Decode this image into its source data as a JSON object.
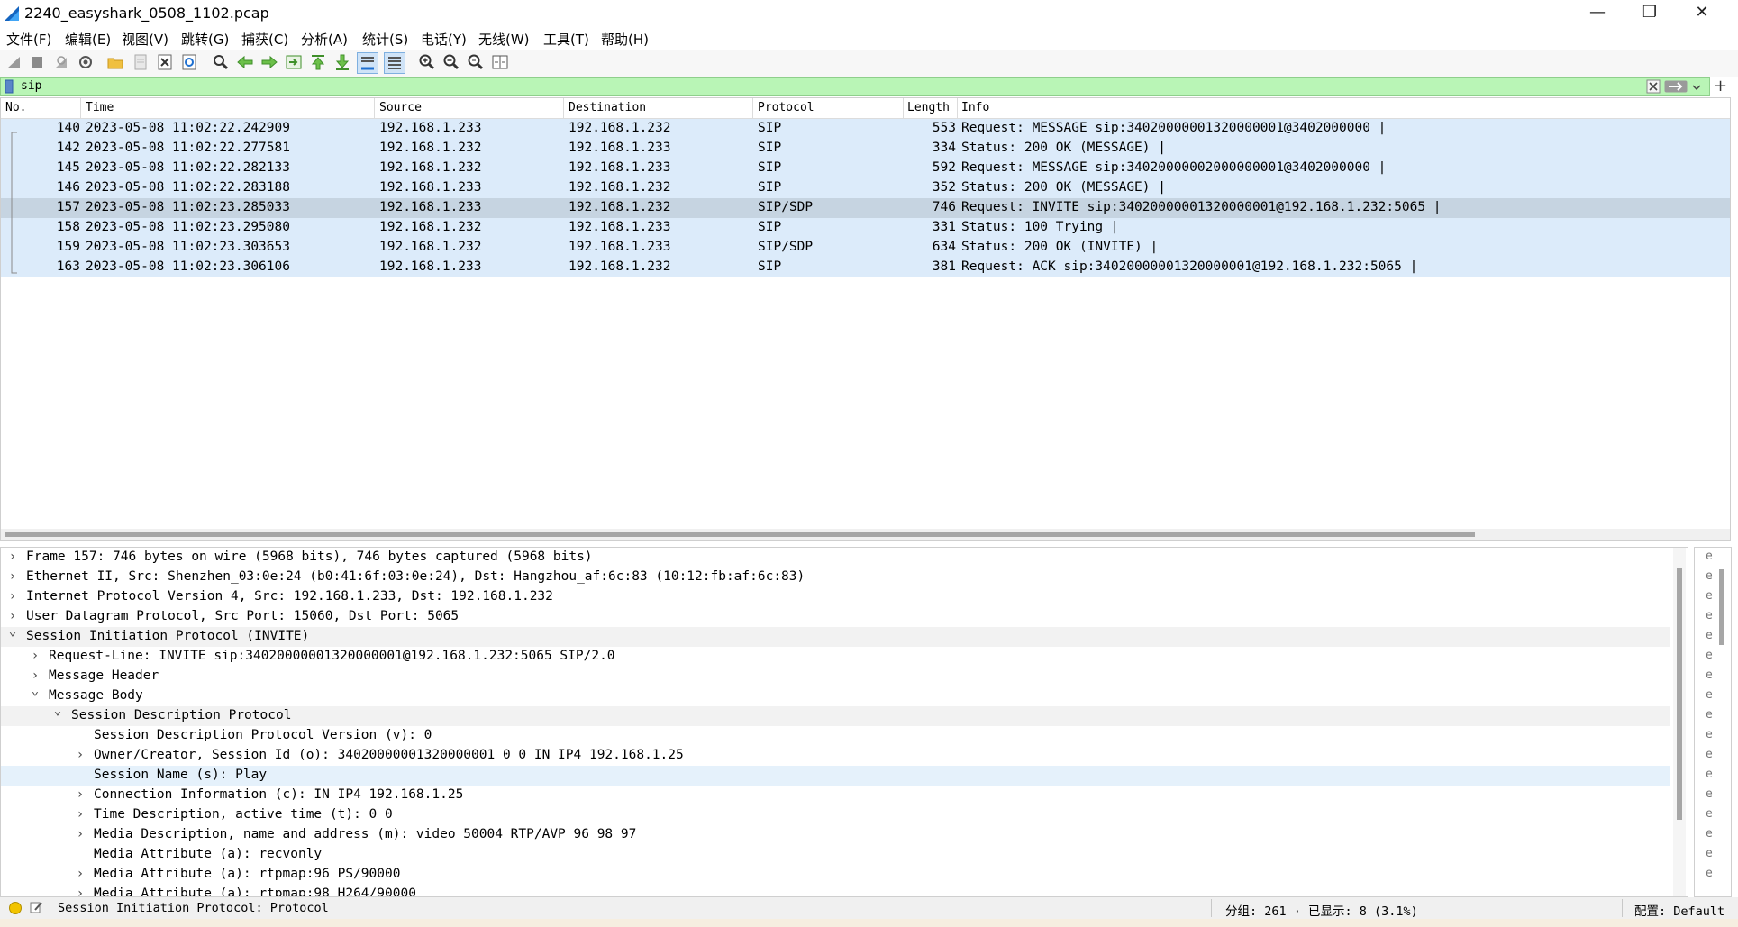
{
  "window": {
    "title": "2240_easyshark_0508_1102.pcap",
    "minimize": "—",
    "maximize": "❐",
    "close": "✕"
  },
  "menu": [
    "文件(F)",
    "编辑(E)",
    "视图(V)",
    "跳转(G)",
    "捕获(C)",
    "分析(A)",
    "统计(S)",
    "电话(Y)",
    "无线(W)",
    "工具(T)",
    "帮助(H)"
  ],
  "toolbar": {
    "icons": [
      "start-capture-icon",
      "stop-capture-icon",
      "restart-capture-icon",
      "capture-options-icon",
      "open-file-icon",
      "save-file-icon",
      "close-file-icon",
      "reload-file-icon",
      "find-packet-icon",
      "go-back-icon",
      "go-forward-icon",
      "go-to-packet-icon",
      "go-first-packet-icon",
      "go-last-packet-icon",
      "auto-scroll-icon",
      "colorize-icon",
      "zoom-in-icon",
      "zoom-out-icon",
      "zoom-normal-icon",
      "resize-columns-icon"
    ]
  },
  "filter": {
    "value": "sip",
    "add": "+"
  },
  "packet_list": {
    "columns": [
      "No.",
      "Time",
      "Source",
      "Destination",
      "Protocol",
      "Length",
      "Info"
    ],
    "rows": [
      {
        "no": "140",
        "time": "2023-05-08 11:02:22.242909",
        "src": "192.168.1.233",
        "dst": "192.168.1.232",
        "proto": "SIP",
        "len": "553",
        "info": "Request: MESSAGE sip:34020000001320000001@3402000000 |"
      },
      {
        "no": "142",
        "time": "2023-05-08 11:02:22.277581",
        "src": "192.168.1.232",
        "dst": "192.168.1.233",
        "proto": "SIP",
        "len": "334",
        "info": "Status: 200 OK (MESSAGE) |"
      },
      {
        "no": "145",
        "time": "2023-05-08 11:02:22.282133",
        "src": "192.168.1.232",
        "dst": "192.168.1.233",
        "proto": "SIP",
        "len": "592",
        "info": "Request: MESSAGE sip:34020000002000000001@3402000000 |"
      },
      {
        "no": "146",
        "time": "2023-05-08 11:02:22.283188",
        "src": "192.168.1.233",
        "dst": "192.168.1.232",
        "proto": "SIP",
        "len": "352",
        "info": "Status: 200 OK (MESSAGE) |"
      },
      {
        "no": "157",
        "time": "2023-05-08 11:02:23.285033",
        "src": "192.168.1.233",
        "dst": "192.168.1.232",
        "proto": "SIP/SDP",
        "len": "746",
        "info": "Request: INVITE sip:34020000001320000001@192.168.1.232:5065 |",
        "selected": true
      },
      {
        "no": "158",
        "time": "2023-05-08 11:02:23.295080",
        "src": "192.168.1.232",
        "dst": "192.168.1.233",
        "proto": "SIP",
        "len": "331",
        "info": "Status: 100 Trying |"
      },
      {
        "no": "159",
        "time": "2023-05-08 11:02:23.303653",
        "src": "192.168.1.232",
        "dst": "192.168.1.233",
        "proto": "SIP/SDP",
        "len": "634",
        "info": "Status: 200 OK (INVITE) |"
      },
      {
        "no": "163",
        "time": "2023-05-08 11:02:23.306106",
        "src": "192.168.1.233",
        "dst": "192.168.1.232",
        "proto": "SIP",
        "len": "381",
        "info": "Request: ACK sip:34020000001320000001@192.168.1.232:5065 |"
      }
    ]
  },
  "details": {
    "rows": [
      {
        "level": 0,
        "state": "collapsed",
        "text": "Frame 157: 746 bytes on wire (5968 bits), 746 bytes captured (5968 bits)"
      },
      {
        "level": 0,
        "state": "collapsed",
        "text": "Ethernet II, Src: Shenzhen_03:0e:24 (b0:41:6f:03:0e:24), Dst: Hangzhou_af:6c:83 (10:12:fb:af:6c:83)"
      },
      {
        "level": 0,
        "state": "collapsed",
        "text": "Internet Protocol Version 4, Src: 192.168.1.233, Dst: 192.168.1.232"
      },
      {
        "level": 0,
        "state": "collapsed",
        "text": "User Datagram Protocol, Src Port: 15060, Dst Port: 5065"
      },
      {
        "level": 0,
        "state": "expanded",
        "text": "Session Initiation Protocol (INVITE)"
      },
      {
        "level": 1,
        "state": "collapsed",
        "text": "Request-Line: INVITE sip:34020000001320000001@192.168.1.232:5065 SIP/2.0"
      },
      {
        "level": 1,
        "state": "collapsed",
        "text": "Message Header"
      },
      {
        "level": 1,
        "state": "expanded",
        "text": "Message Body"
      },
      {
        "level": 2,
        "state": "expanded",
        "text": "Session Description Protocol"
      },
      {
        "level": 3,
        "state": "none",
        "text": "Session Description Protocol Version (v): 0"
      },
      {
        "level": 3,
        "state": "collapsed",
        "text": "Owner/Creator, Session Id (o): 34020000001320000001 0 0 IN IP4 192.168.1.25"
      },
      {
        "level": 3,
        "state": "none",
        "text": "Session Name (s): Play",
        "selected": true
      },
      {
        "level": 3,
        "state": "collapsed",
        "text": "Connection Information (c): IN IP4 192.168.1.25"
      },
      {
        "level": 3,
        "state": "collapsed",
        "text": "Time Description, active time (t): 0 0"
      },
      {
        "level": 3,
        "state": "collapsed",
        "text": "Media Description, name and address (m): video 50004 RTP/AVP 96 98 97"
      },
      {
        "level": 3,
        "state": "none",
        "text": "Media Attribute (a): recvonly"
      },
      {
        "level": 3,
        "state": "collapsed",
        "text": "Media Attribute (a): rtpmap:96 PS/90000"
      },
      {
        "level": 3,
        "state": "collapsed",
        "text": "Media Attribute (a): rtpmap:98 H264/90000"
      }
    ]
  },
  "bytes_pane": {
    "glyph": "e"
  },
  "status": {
    "field": "Session Initiation Protocol: Protocol",
    "packets": "分组: 261 · 已显示: 8 (3.1%)",
    "profile": "配置: Default"
  },
  "colors": {
    "filter_valid_bg": "#b9f5b6",
    "sip_row_bg": "#dcebfa",
    "selected_row_bg": "#c6d4e1",
    "details_selected_bg": "#e5f1fb"
  }
}
